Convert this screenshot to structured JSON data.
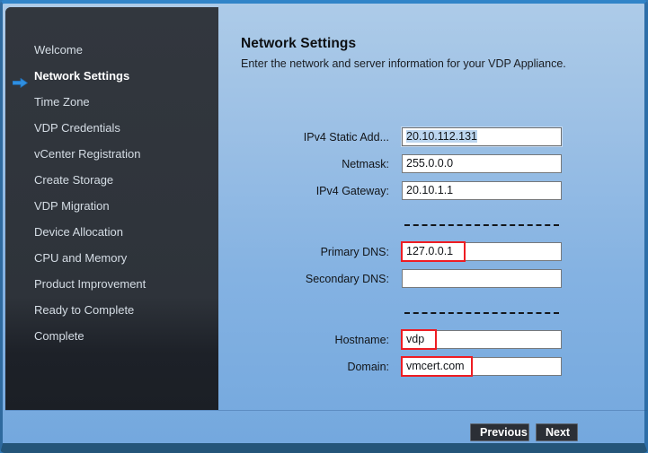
{
  "window": {
    "accent_blue": "#3184c8",
    "panel_gradient_top": "#adcbe8",
    "panel_gradient_bottom": "#74a8de",
    "sidebar_bg": "#2f343b",
    "annotation_color": "#ee1c22"
  },
  "sidebar": {
    "items": [
      {
        "label": "Welcome",
        "active": false
      },
      {
        "label": "Network Settings",
        "active": true
      },
      {
        "label": "Time Zone",
        "active": false
      },
      {
        "label": "VDP Credentials",
        "active": false
      },
      {
        "label": "vCenter Registration",
        "active": false
      },
      {
        "label": "Create Storage",
        "active": false
      },
      {
        "label": "VDP Migration",
        "active": false
      },
      {
        "label": "Device Allocation",
        "active": false
      },
      {
        "label": "CPU and Memory",
        "active": false
      },
      {
        "label": "Product Improvement",
        "active": false
      },
      {
        "label": "Ready to Complete",
        "active": false
      },
      {
        "label": "Complete",
        "active": false
      }
    ],
    "active_arrow_icon": "arrow-right-icon"
  },
  "main": {
    "title": "Network Settings",
    "subtitle": "Enter the network and server information for your VDP Appliance.",
    "fields": [
      {
        "label": "IPv4 Static Add...",
        "value": "20.10.112.131",
        "placeholder": "",
        "selected": true,
        "focused": true,
        "annotated": false,
        "annot_width": 0
      },
      {
        "label": "Netmask:",
        "value": "255.0.0.0",
        "placeholder": "",
        "selected": false,
        "focused": false,
        "annotated": false,
        "annot_width": 0
      },
      {
        "label": "IPv4 Gateway:",
        "value": "20.10.1.1",
        "placeholder": "",
        "selected": false,
        "focused": false,
        "annotated": false,
        "annot_width": 0
      },
      {
        "label": "Primary DNS:",
        "value": "127.0.0.1",
        "placeholder": "",
        "selected": false,
        "focused": false,
        "annotated": true,
        "annot_width": 72
      },
      {
        "label": "Secondary DNS:",
        "value": "",
        "placeholder": "",
        "selected": false,
        "focused": false,
        "annotated": false,
        "annot_width": 0
      },
      {
        "label": "Hostname:",
        "value": "vdp",
        "placeholder": "",
        "selected": false,
        "focused": false,
        "annotated": true,
        "annot_width": 40
      },
      {
        "label": "Domain:",
        "value": "vmcert.com",
        "placeholder": "",
        "selected": false,
        "focused": false,
        "annotated": true,
        "annot_width": 80
      }
    ]
  },
  "footer": {
    "previous_label": "Previous",
    "next_label": "Next"
  }
}
